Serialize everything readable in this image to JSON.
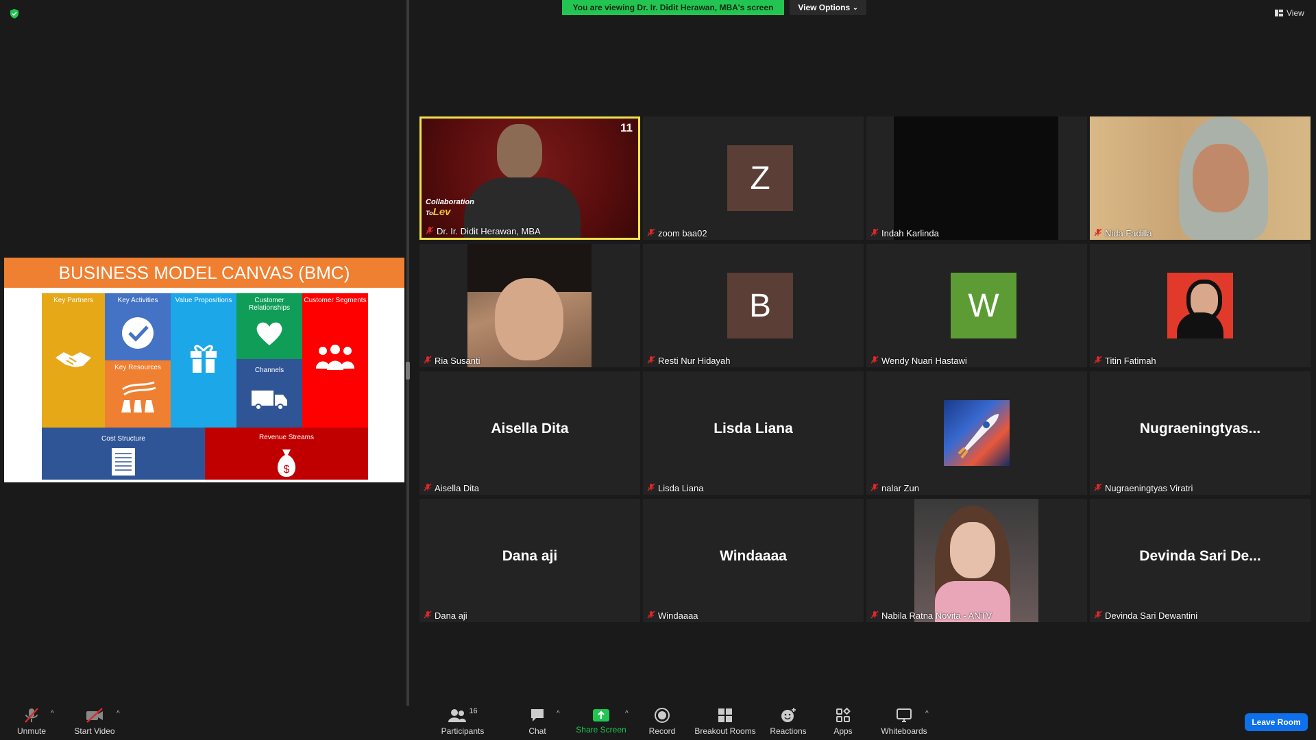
{
  "top": {
    "banner": "You are viewing Dr. Ir. Didit Herawan, MBA's screen",
    "view_options": "View Options",
    "view": "View"
  },
  "slide": {
    "title": "BUSINESS MODEL CANVAS (BMC)",
    "cells": {
      "key_partners": "Key Partners",
      "key_activities": "Key Activities",
      "key_resources": "Key Resources",
      "value_propositions": "Value Propositions",
      "customer_relationships": "Customer Relationships",
      "channels": "Channels",
      "customer_segments": "Customer Segments",
      "cost_structure": "Cost Structure",
      "revenue_streams": "Revenue Streams"
    },
    "colors": {
      "key_partners": "#e6a817",
      "key_activities": "#4472c4",
      "key_resources": "#ef7f31",
      "value_propositions": "#1ca7e8",
      "customer_relationships": "#0f9d58",
      "channels": "#2f5597",
      "customer_segments": "#ff0000",
      "cost_structure": "#2f5597",
      "revenue_streams": "#c00000"
    }
  },
  "tiles": [
    {
      "label": "Dr. Ir. Didit Herawan, MBA",
      "type": "video",
      "active": true,
      "overlay": [
        "Collaboration",
        "To",
        "Lev",
        "11"
      ]
    },
    {
      "label": "zoom baa02",
      "type": "avatar",
      "letter": "Z",
      "color": "#5b3e36"
    },
    {
      "label": "Indah Karlinda",
      "type": "dark-video"
    },
    {
      "label": "Nida Fadilla",
      "type": "video-light"
    },
    {
      "label": "Ria Susanti",
      "type": "video-face"
    },
    {
      "label": "Resti Nur Hidayah",
      "type": "avatar",
      "letter": "B",
      "color": "#5b3e36"
    },
    {
      "label": "Wendy Nuari Hastawi",
      "type": "avatar",
      "letter": "W",
      "color": "#5d9c34"
    },
    {
      "label": "Titin Fatimah",
      "type": "photo-red"
    },
    {
      "label": "Aisella Dita",
      "type": "name",
      "big": "Aisella Dita"
    },
    {
      "label": "Lisda Liana",
      "type": "name",
      "big": "Lisda Liana"
    },
    {
      "label": "nalar Zun",
      "type": "rocket"
    },
    {
      "label": "Nugraeningtyas Viratri",
      "type": "name",
      "big": "Nugraeningtyas..."
    },
    {
      "label": "Dana aji",
      "type": "name",
      "big": "Dana aji"
    },
    {
      "label": "Windaaaa",
      "type": "name",
      "big": "Windaaaa"
    },
    {
      "label": "Nabila Ratna Novita - ANTV",
      "type": "video-pink"
    },
    {
      "label": "Devinda Sari Dewantini",
      "type": "name",
      "big": "Devinda Sari De..."
    }
  ],
  "toolbar": {
    "unmute": "Unmute",
    "start_video": "Start Video",
    "participants": "Participants",
    "participants_count": "16",
    "chat": "Chat",
    "share_screen": "Share Screen",
    "record": "Record",
    "breakout_rooms": "Breakout Rooms",
    "reactions": "Reactions",
    "apps": "Apps",
    "whiteboards": "Whiteboards",
    "leave": "Leave Room"
  },
  "colors": {
    "banner": "#23c552",
    "share_green": "#23c552",
    "leave_blue": "#0e71eb",
    "active_border": "#f2e34c",
    "mic_off_red": "#e02828"
  }
}
